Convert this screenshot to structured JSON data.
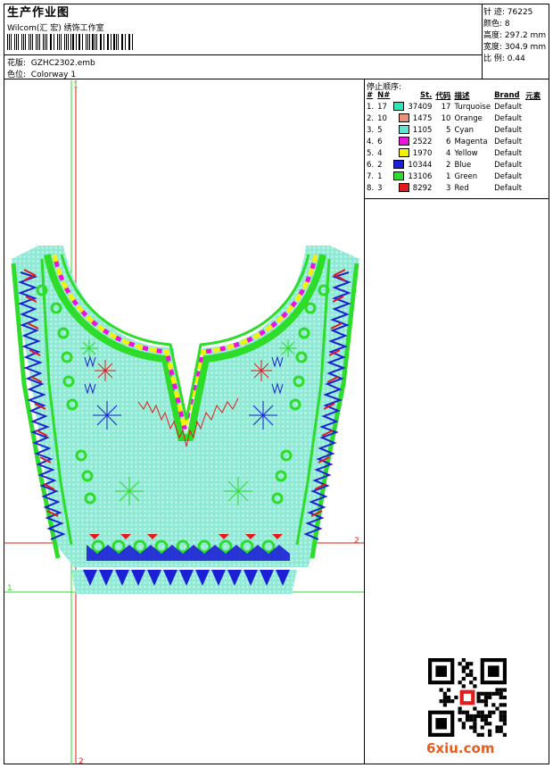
{
  "header": {
    "title": "生产作业图",
    "subtitle": "Wilcom(汇 宏) 绣饰工作室",
    "design_label": "花版:",
    "design_value": "GZHC2302.emb",
    "colorway_label": "色位:",
    "colorway_value": "Colorway 1"
  },
  "stats": {
    "stitches_label": "针 迹:",
    "stitches_value": "76225",
    "colors_label": "颜色:",
    "colors_value": "8",
    "height_label": "高度:",
    "height_value": "297.2 mm",
    "width_label": "宽度:",
    "width_value": "304.9 mm",
    "scale_label": "比 例:",
    "scale_value": "0.44"
  },
  "stop_sequence": {
    "title": "停止顺序:",
    "headers": [
      "#",
      "N#",
      "St.",
      "代码",
      "描述",
      "Brand",
      "元素"
    ],
    "rows": [
      {
        "idx": "1.",
        "n": "17",
        "color": "#2fe6b9",
        "st": "37409",
        "code": "17",
        "desc": "Turquoise",
        "brand": "Default"
      },
      {
        "idx": "2.",
        "n": "10",
        "color": "#e8937a",
        "st": "1475",
        "code": "10",
        "desc": "Orange",
        "brand": "Default"
      },
      {
        "idx": "3.",
        "n": "5",
        "color": "#62e3d2",
        "st": "1105",
        "code": "5",
        "desc": "Cyan",
        "brand": "Default"
      },
      {
        "idx": "4.",
        "n": "6",
        "color": "#ec13e0",
        "st": "2522",
        "code": "6",
        "desc": "Magenta",
        "brand": "Default"
      },
      {
        "idx": "5.",
        "n": "4",
        "color": "#f3f00c",
        "st": "1970",
        "code": "4",
        "desc": "Yellow",
        "brand": "Default"
      },
      {
        "idx": "6.",
        "n": "2",
        "color": "#1b20d6",
        "st": "10344",
        "code": "2",
        "desc": "Blue",
        "brand": "Default"
      },
      {
        "idx": "7.",
        "n": "1",
        "color": "#2edc2a",
        "st": "13106",
        "code": "1",
        "desc": "Green",
        "brand": "Default"
      },
      {
        "idx": "8.",
        "n": "3",
        "color": "#e21c1c",
        "st": "8292",
        "code": "3",
        "desc": "Red",
        "brand": "Default"
      }
    ]
  },
  "guides": {
    "label_h1": "1",
    "label_h2": "2",
    "label_v1": "1",
    "label_v2": "2"
  },
  "watermark": "6xiu.com"
}
